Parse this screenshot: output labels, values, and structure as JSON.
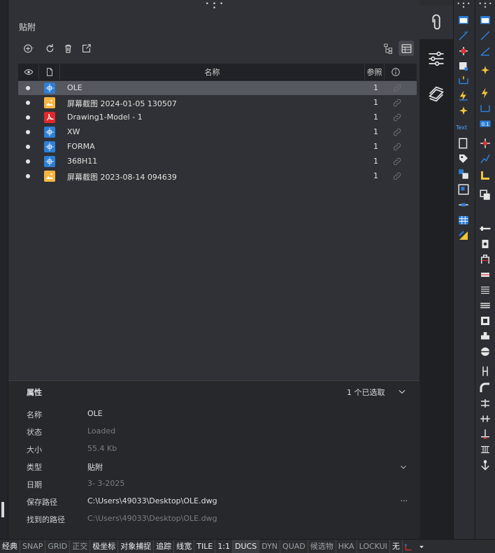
{
  "palette": {
    "title": "贴附",
    "columns": {
      "name": "名称",
      "ref": "参照"
    },
    "rows": [
      {
        "name": "OLE",
        "ref": "1",
        "type": "dwg",
        "selected": true
      },
      {
        "name": "屏幕截图 2024-01-05 130507",
        "ref": "1",
        "type": "image",
        "selected": false
      },
      {
        "name": "Drawing1-Model - 1",
        "ref": "1",
        "type": "pdf",
        "selected": false
      },
      {
        "name": "XW",
        "ref": "1",
        "type": "dwg",
        "selected": false
      },
      {
        "name": "FORMA",
        "ref": "1",
        "type": "dwg",
        "selected": false
      },
      {
        "name": "368H11",
        "ref": "1",
        "type": "dwg",
        "selected": false
      },
      {
        "name": "屏幕截图 2023-08-14 094639",
        "ref": "1",
        "type": "image",
        "selected": false
      }
    ]
  },
  "properties": {
    "header": "属性",
    "selection_count": "1 个已选取",
    "items": [
      {
        "label": "名称",
        "value": "OLE",
        "dim": false,
        "action": ""
      },
      {
        "label": "状态",
        "value": "Loaded",
        "dim": true,
        "action": ""
      },
      {
        "label": "大小",
        "value": "55.4 Kb",
        "dim": true,
        "action": ""
      },
      {
        "label": "类型",
        "value": "贴附",
        "dim": false,
        "action": "chevron"
      },
      {
        "label": "日期",
        "value": "3- 3-2025",
        "dim": true,
        "action": ""
      },
      {
        "label": "保存路径",
        "value": "C:\\Users\\49033\\Desktop\\OLE.dwg",
        "dim": false,
        "action": "···"
      },
      {
        "label": "找到的路径",
        "value": "C:\\Users\\49033\\Desktop\\OLE.dwg",
        "dim": true,
        "action": ""
      }
    ]
  },
  "toolbar": {
    "text_tool_label": "Text"
  },
  "statusbar": {
    "items": [
      {
        "label": "经典",
        "on": true,
        "hi": false
      },
      {
        "label": "SNAP",
        "on": false,
        "hi": false
      },
      {
        "label": "GRID",
        "on": false,
        "hi": false
      },
      {
        "label": "正交",
        "on": false,
        "hi": false
      },
      {
        "label": "极坐标",
        "on": true,
        "hi": false
      },
      {
        "label": "对象捕捉",
        "on": true,
        "hi": false
      },
      {
        "label": "追踪",
        "on": true,
        "hi": false
      },
      {
        "label": "线宽",
        "on": true,
        "hi": false
      },
      {
        "label": "TILE",
        "on": true,
        "hi": false
      },
      {
        "label": "1:1",
        "on": true,
        "hi": false
      },
      {
        "label": "DUCS",
        "on": true,
        "hi": true
      },
      {
        "label": "DYN",
        "on": false,
        "hi": false
      },
      {
        "label": "QUAD",
        "on": false,
        "hi": false
      },
      {
        "label": "候选物",
        "on": false,
        "hi": false
      },
      {
        "label": "HKA",
        "on": false,
        "hi": false
      },
      {
        "label": "LOCKUI",
        "on": false,
        "hi": false
      },
      {
        "label": "无",
        "on": true,
        "hi": false
      }
    ]
  },
  "colors": {
    "accent": "#2d7fd6",
    "pdf": "#e0282c",
    "image": "#f5b642",
    "selected_row": "#55585e"
  }
}
